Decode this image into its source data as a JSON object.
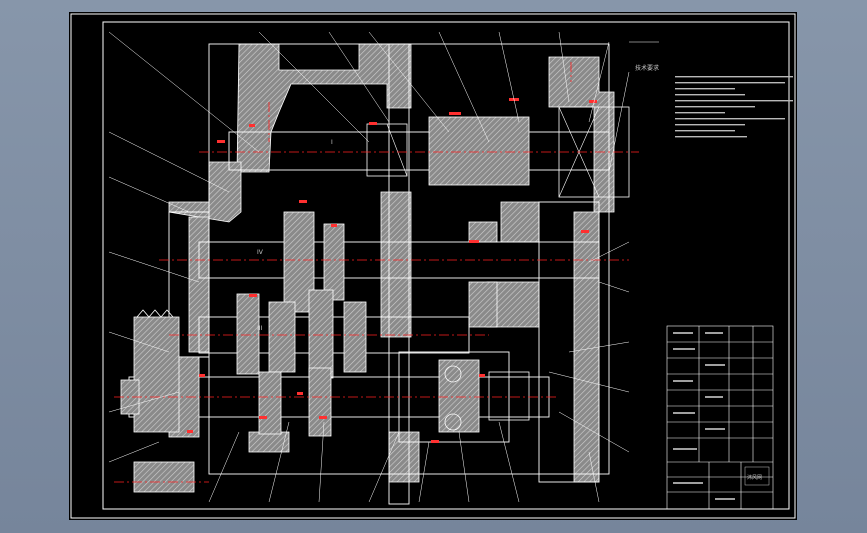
{
  "drawing": {
    "tech_requirements_title": "技术要求",
    "shaft_labels": [
      "I",
      "IV",
      "III"
    ],
    "notes_count": 9
  },
  "colors": {
    "background": "#000000",
    "line": "#ffffff",
    "section": "#9a9a9a",
    "centerline": "#ff2020",
    "viewport": "#7f8ea3"
  },
  "title_block": {
    "logo_text": "沐风网"
  }
}
